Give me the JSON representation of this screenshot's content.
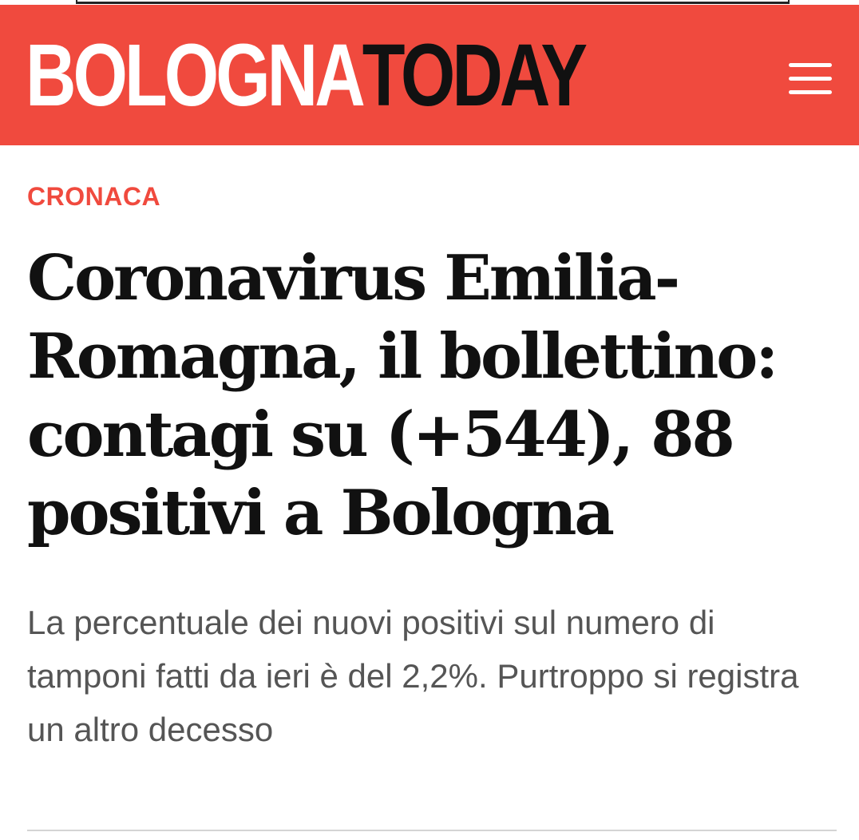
{
  "header": {
    "logo_part_a": "BOLOGNA",
    "logo_part_b": "TODAY",
    "menu_icon": "hamburger-menu-icon",
    "brand_color": "#f04a3e"
  },
  "article": {
    "category": "CRONACA",
    "title": "Coronavirus Emilia-Romagna, il bollettino: contagi su (+544), 88 positivi a Bologna",
    "summary": "La percentuale dei nuovi positivi sul numero di tamponi fatti da ieri è del 2,2%. Purtroppo si registra un altro decesso"
  }
}
